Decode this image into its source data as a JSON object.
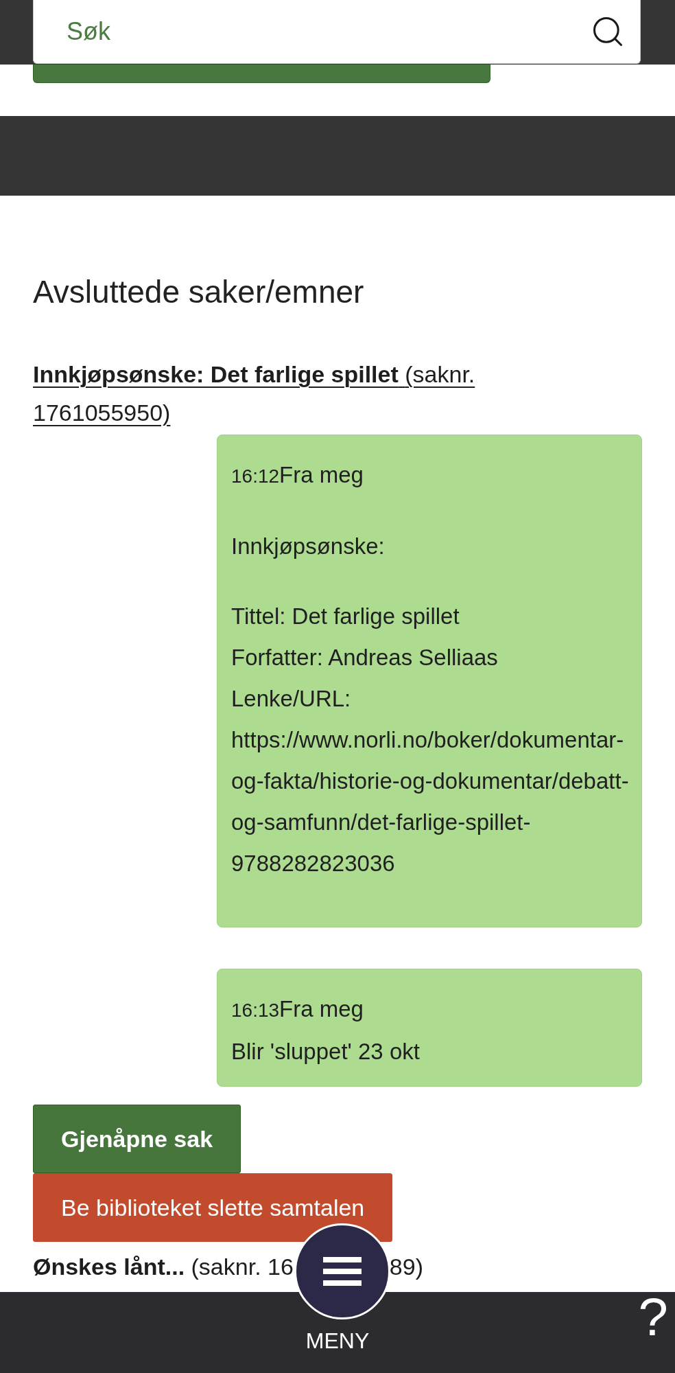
{
  "search": {
    "placeholder": "Søk"
  },
  "section": {
    "title": "Avsluttede saker/emner"
  },
  "cases": [
    {
      "title": "Innkjøpsønske: Det farlige spillet",
      "case_number": [
        "(saknr. 1761055950)"
      ],
      "expanded": true,
      "messages": [
        {
          "kind": "paragraphs",
          "time": "16:12",
          "sender": "Fra meg",
          "paragraphs": [
            [
              "Innkjøpsønske:"
            ],
            [
              "Tittel: Det farlige spillet",
              "Forfatter: Andreas Selliaas",
              "Lenke/URL: https://www.norli.no/boker/dokumentar-og-fakta/historie-og-dokumentar/debatt-og-samfunn/det-farlige-spillet-9788282823036"
            ]
          ]
        },
        {
          "kind": "plain",
          "time": "16:13",
          "sender": "Fra meg",
          "paragraphs": [
            [
              "Blir 'sluppet' 23 okt"
            ]
          ]
        }
      ],
      "buttons": [
        {
          "label": "Gjenåpne sak",
          "kind": "primary"
        },
        {
          "label": "Be biblioteket slette samtalen",
          "kind": "danger"
        }
      ]
    },
    {
      "title": "Ønskes lånt...",
      "case_number": [
        "(saknr. 16",
        "89)"
      ],
      "expanded": false
    }
  ],
  "bottom_bar": {
    "menu_label": "MENY",
    "help": "?"
  }
}
